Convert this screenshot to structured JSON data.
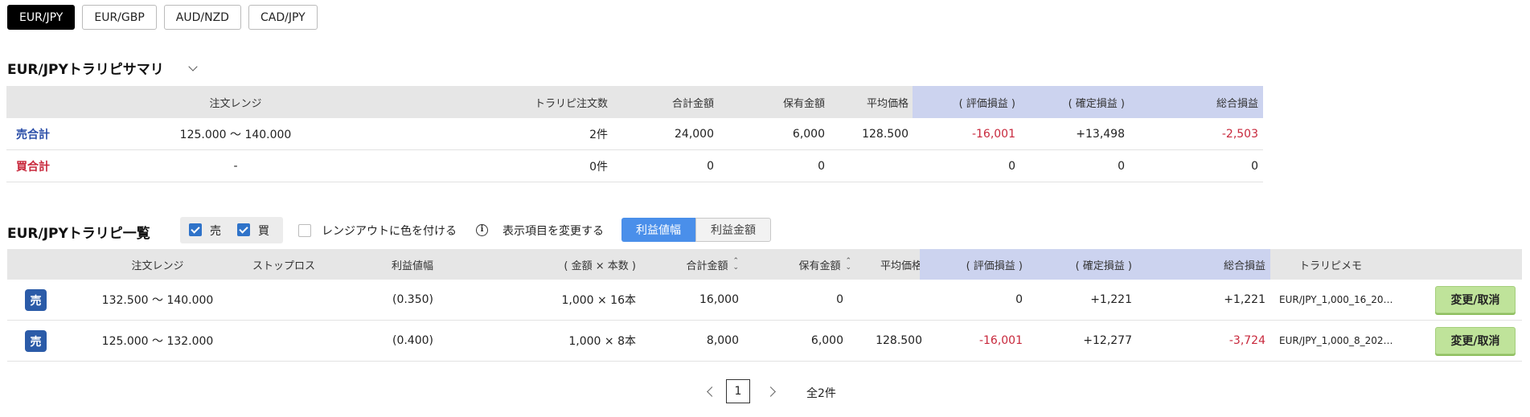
{
  "pair_tabs": [
    "EUR/JPY",
    "EUR/GBP",
    "AUD/NZD",
    "CAD/JPY"
  ],
  "summary": {
    "title": "EUR/JPYトラリピサマリ",
    "headers": [
      "注文レンジ",
      "トラリピ注文数",
      "合計金額",
      "保有金額",
      "平均価格",
      "( 評価損益 )",
      "( 確定損益 )",
      "総合損益"
    ],
    "rows": [
      {
        "label": "売合計",
        "range": "125.000 〜 140.000",
        "count": "2件",
        "total": "24,000",
        "holding": "6,000",
        "avg": "128.500",
        "unrealized": "-16,001",
        "realized": "+13,498",
        "overall": "-2,503"
      },
      {
        "label": "買合計",
        "range": "-",
        "count": "0件",
        "total": "0",
        "holding": "0",
        "avg": "",
        "unrealized": "0",
        "realized": "0",
        "overall": "0"
      }
    ]
  },
  "list": {
    "title": "EUR/JPYトラリピ一覧",
    "filter_sell": "売",
    "filter_buy": "買",
    "range_out_label": "レンジアウトに色を付ける",
    "display_label": "表示項目を変更する",
    "seg_profit_width": "利益値幅",
    "seg_profit_amount": "利益金額",
    "headers": [
      "注文レンジ",
      "ストップロス",
      "利益値幅",
      "( 金額 × 本数 )",
      "合計金額",
      "保有金額",
      "平均価格",
      "( 評価損益 )",
      "( 確定損益 )",
      "総合損益",
      "トラリピメモ"
    ],
    "rows": [
      {
        "side": "売",
        "range": "132.500 〜 140.000",
        "stoploss": "",
        "width": "(0.350)",
        "qty": "1,000 × 16本",
        "total": "16,000",
        "holding": "0",
        "avg": "",
        "unrealized": "0",
        "realized": "+1,221",
        "overall": "+1,221",
        "memo": "EUR/JPY_1,000_16_20…",
        "action": "変更/取消"
      },
      {
        "side": "売",
        "range": "125.000 〜 132.000",
        "stoploss": "",
        "width": "(0.400)",
        "qty": "1,000 × 8本",
        "total": "8,000",
        "holding": "6,000",
        "avg": "128.500",
        "unrealized": "-16,001",
        "realized": "+12,277",
        "overall": "-3,724",
        "memo": "EUR/JPY_1,000_8_202…",
        "action": "変更/取消"
      }
    ]
  },
  "pagination": {
    "current": "1",
    "total_label": "全2件"
  },
  "colors": {
    "accent": "#4a8fea",
    "negative": "#c8283c",
    "sell": "#2b5ba8",
    "highlight": "#ccd3ef",
    "action": "#bfe39a"
  }
}
